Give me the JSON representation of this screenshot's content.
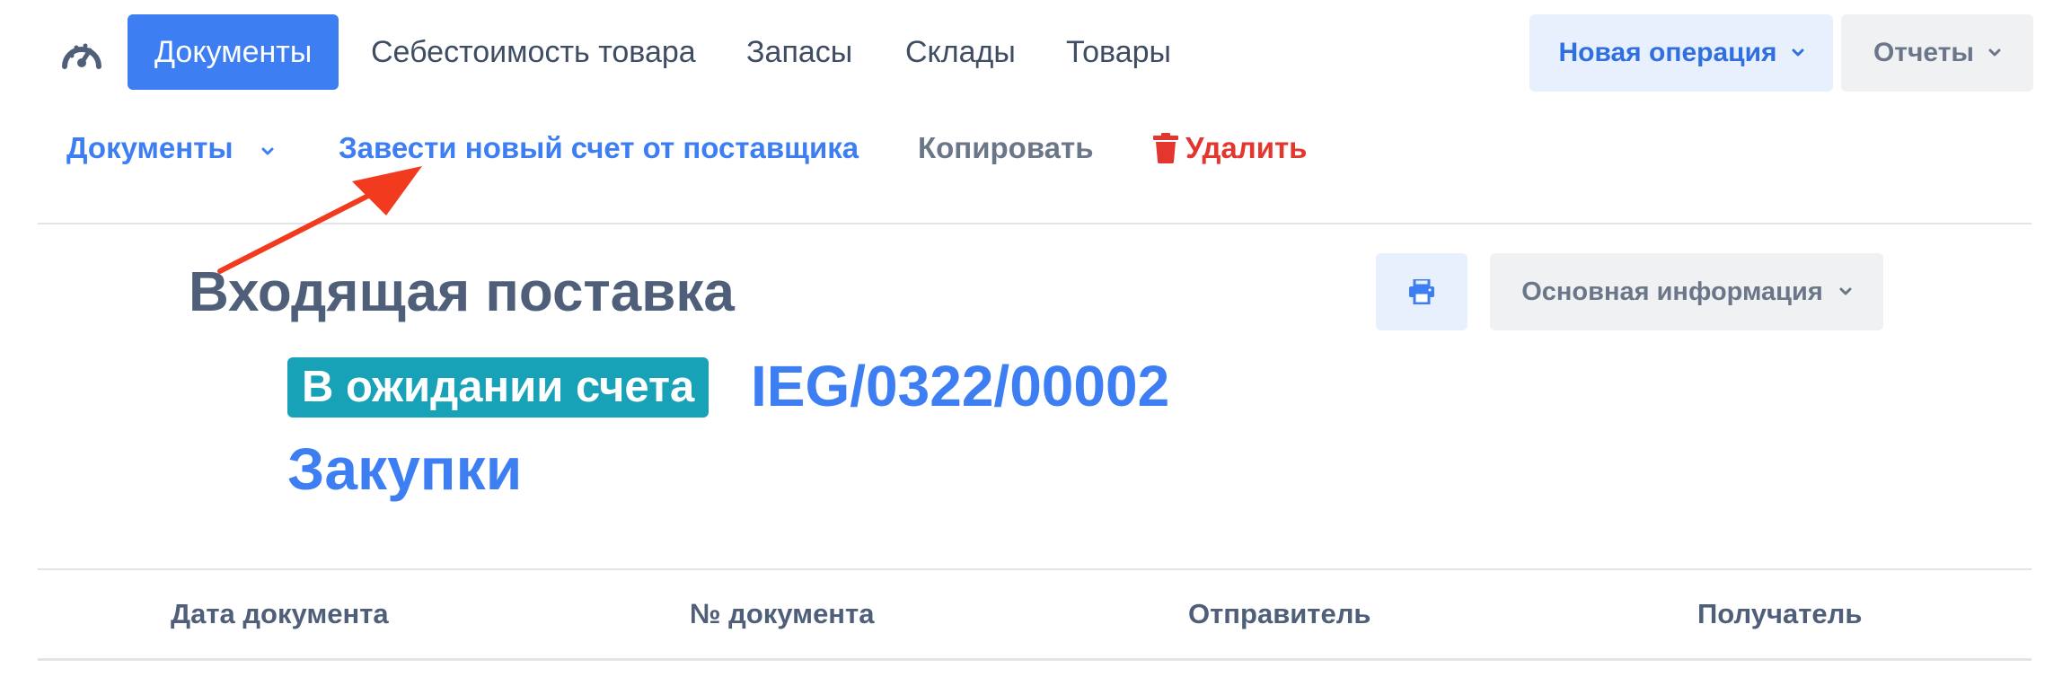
{
  "topnav": {
    "dashboard_icon": "dashboard-gauge-icon",
    "tabs": [
      {
        "label": "Документы",
        "active": true
      },
      {
        "label": "Себестоимость товара",
        "active": false
      },
      {
        "label": "Запасы",
        "active": false
      },
      {
        "label": "Склады",
        "active": false
      },
      {
        "label": "Товары",
        "active": false
      }
    ],
    "new_operation_label": "Новая операция",
    "reports_label": "Отчеты"
  },
  "actions": {
    "documents_label": "Документы",
    "new_invoice_label": "Завести новый счет от поставщика",
    "copy_label": "Копировать",
    "delete_label": "Удалить"
  },
  "document": {
    "title": "Входящая поставка",
    "status_badge": "В ожидании счета",
    "number": "IEG/0322/00002",
    "category": "Закупки",
    "main_info_label": "Основная информация"
  },
  "table": {
    "headers": [
      "Дата документа",
      "№ документа",
      "Отправитель",
      "Получатель"
    ]
  },
  "colors": {
    "primary": "#3d7ef3",
    "badge": "#17a2b8",
    "danger": "#e2362e",
    "annotation_arrow": "#f23a1e"
  }
}
